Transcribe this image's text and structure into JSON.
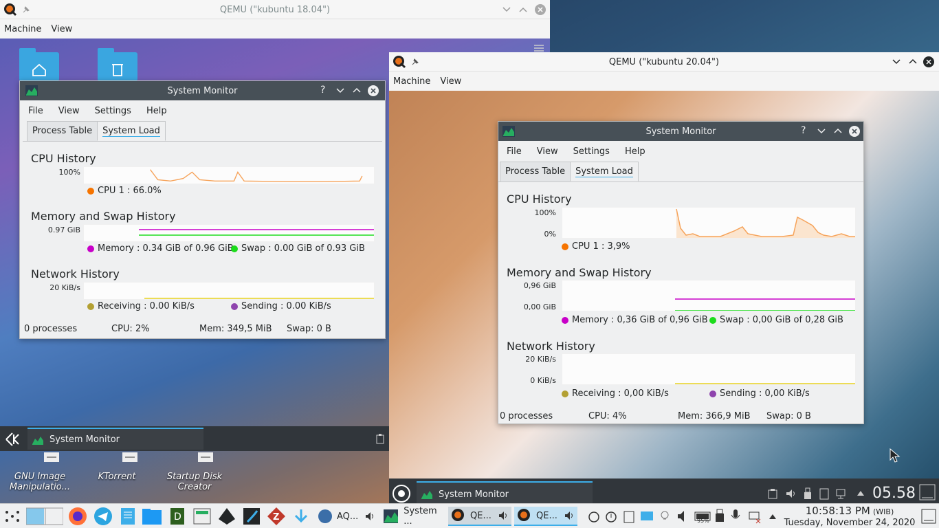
{
  "q1": {
    "title": "QEMU (\"kubuntu 18.04\")",
    "menu": [
      "Machine",
      "View"
    ],
    "sysmon": {
      "title": "System Monitor",
      "menu": [
        "File",
        "View",
        "Settings",
        "Help"
      ],
      "tabs": [
        "Process Table",
        "System Load"
      ],
      "cpu": {
        "title": "CPU History",
        "ymax": "100%",
        "legend": "CPU 1 : 66.0%"
      },
      "mem": {
        "title": "Memory and Swap History",
        "ymax": "0.97 GiB",
        "legend_mem": "Memory : 0.34 GiB of 0.96 GiB",
        "legend_swap": "Swap : 0.00 GiB of 0.93 GiB"
      },
      "net": {
        "title": "Network History",
        "ymax": "20 KiB/s",
        "legend_recv": "Receiving : 0.00 KiB/s",
        "legend_send": "Sending : 0.00 KiB/s"
      },
      "status": {
        "procs": "0 processes",
        "cpu": "CPU: 2%",
        "mem": "Mem: 349,5 MiB",
        "swap": "Swap: 0 B"
      }
    },
    "panel_task": "System Monitor",
    "desktop_icons": [
      "GNU Image Manipulatio...",
      "KTorrent",
      "Startup Disk Creator"
    ]
  },
  "q2": {
    "title": "QEMU (\"kubuntu 20.04\")",
    "menu": [
      "Machine",
      "View"
    ],
    "sysmon": {
      "title": "System Monitor",
      "menu": [
        "File",
        "View",
        "Settings",
        "Help"
      ],
      "tabs": [
        "Process Table",
        "System Load"
      ],
      "cpu": {
        "title": "CPU History",
        "ymax": "100%",
        "ymin": "0%",
        "legend": "CPU 1 : 3,9%"
      },
      "mem": {
        "title": "Memory and Swap History",
        "ymax": "0,96 GiB",
        "ymin": "0,00 GiB",
        "legend_mem": "Memory : 0,36 GiB of 0,96 GiB",
        "legend_swap": "Swap : 0,00 GiB of 0,28 GiB"
      },
      "net": {
        "title": "Network History",
        "ymax": "20 KiB/s",
        "ymin": "0 KiB/s",
        "legend_recv": "Receiving : 0,00 KiB/s",
        "legend_send": "Sending : 0,00 KiB/s"
      },
      "status": {
        "procs": "0 processes",
        "cpu": "CPU: 4%",
        "mem": "Mem: 366,9 MiB",
        "swap": "Swap: 0 B"
      }
    },
    "panel_task": "System Monitor",
    "clock": "05.58"
  },
  "taskbar": {
    "tasks": [
      {
        "label": "AQ..."
      },
      {
        "label": "System ..."
      },
      {
        "label": "QE..."
      },
      {
        "label": "QE..."
      }
    ],
    "battery_label": "95%",
    "time": "10:58:13 PM",
    "tz": "(WIB)",
    "date": "Tuesday, November 24, 2020"
  },
  "colors": {
    "cpu": "#f67400",
    "memory": "#c800c8",
    "swap": "#1cdc1c",
    "receiving": "#b3a033",
    "sending": "#8e44ad",
    "accent": "#3daee9"
  }
}
